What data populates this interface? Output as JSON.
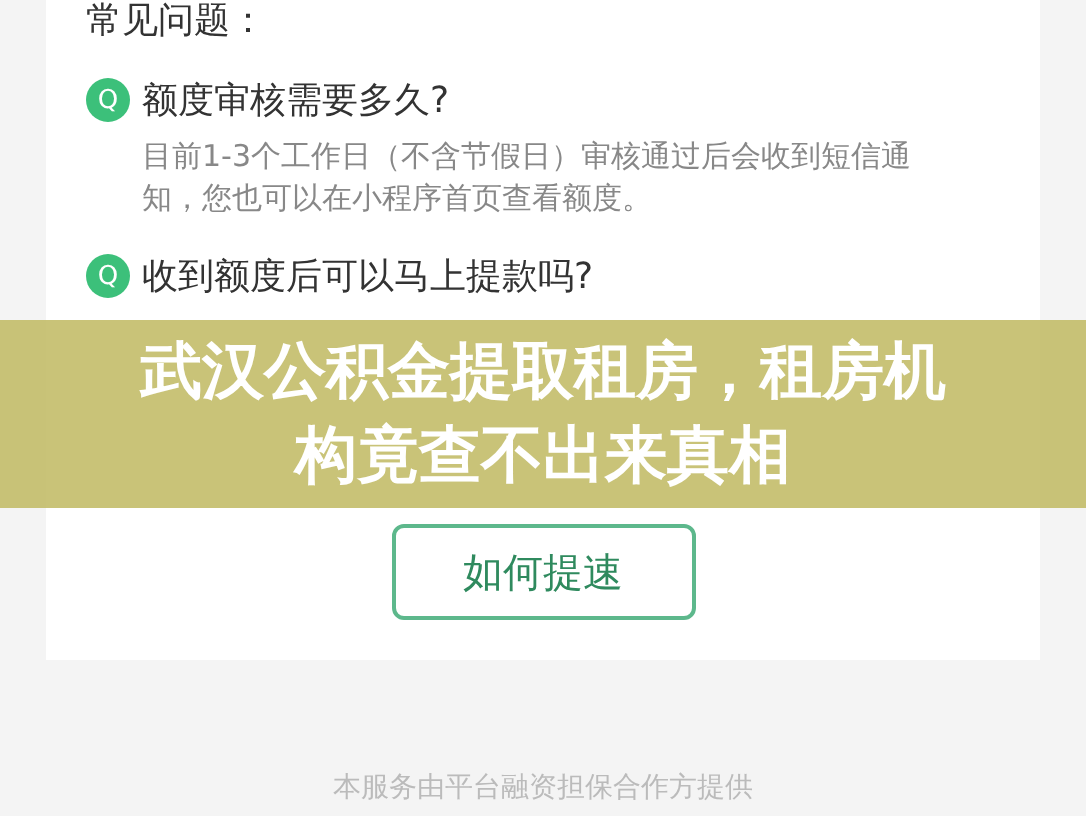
{
  "section_title": "常见问题：",
  "faq": [
    {
      "icon": "Q",
      "question": "额度审核需要多久?",
      "answer_lines": [
        "目前1-3个工作日（不含节假日）审核通过后会收到短信通",
        "知，您也可以在小程序首页查看额度。"
      ]
    },
    {
      "icon": "Q",
      "question": "收到额度后可以马上提款吗?"
    }
  ],
  "button": "如何提速",
  "footer": "本服务由平台融资担保合作方提供",
  "banner": {
    "title": "武汉公积金提取租房，租房机构竟查不出来真相"
  }
}
